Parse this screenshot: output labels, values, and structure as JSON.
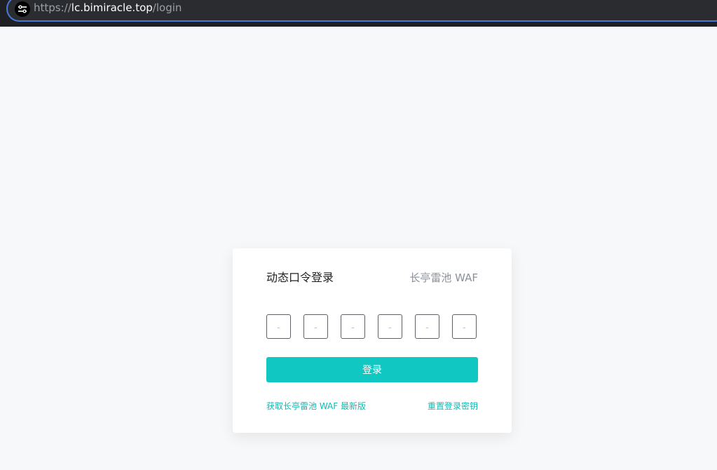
{
  "browser": {
    "url_scheme": "https://",
    "url_host": "lc.bimiracle.top",
    "url_path": "/login"
  },
  "login": {
    "title": "动态口令登录",
    "brand": "长亭雷池 WAF",
    "otp_placeholder": "-",
    "otp_count": 6,
    "submit_label": "登录",
    "get_latest_link": "获取长亭雷池 WAF 最新版",
    "reset_key_link": "重置登录密钥"
  },
  "colors": {
    "accent": "#10c8c1",
    "link": "#10b9b3",
    "background": "#f7f8fa"
  }
}
